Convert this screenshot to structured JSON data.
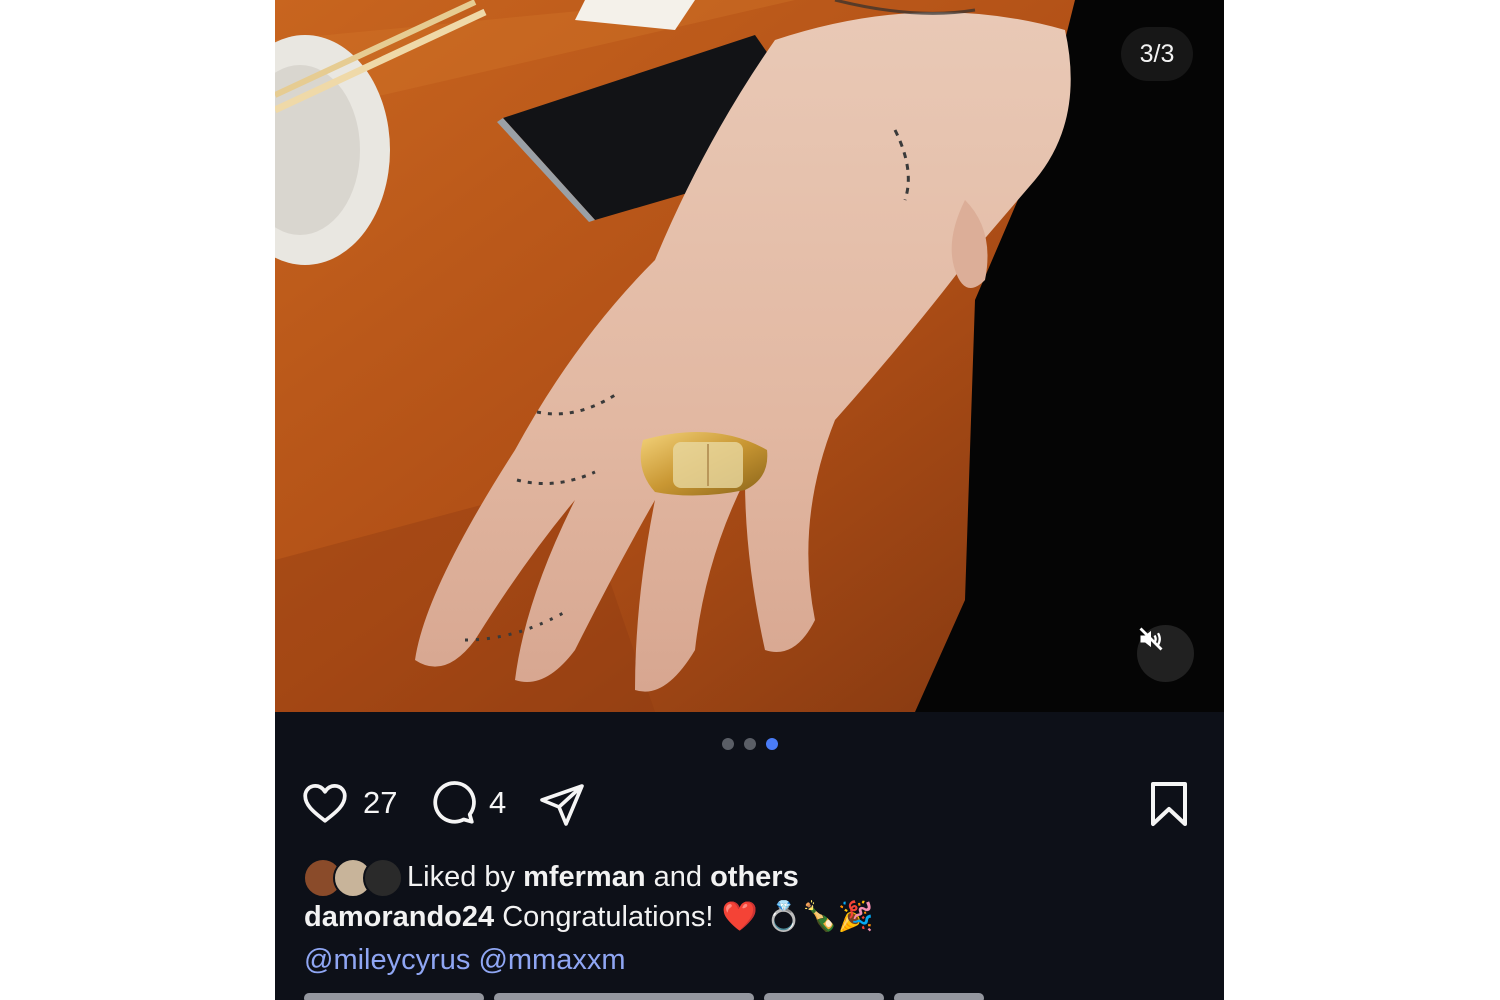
{
  "carousel": {
    "counter": "3/3",
    "total": 3,
    "active_index": 3
  },
  "icons": {
    "mute": "speaker-muted-icon",
    "like": "heart-icon",
    "comment": "speech-bubble-icon",
    "share": "paper-plane-icon",
    "save": "bookmark-icon"
  },
  "actions": {
    "likes_count": "27",
    "comments_count": "4"
  },
  "liked_by": {
    "prefix": "Liked by",
    "user": "mferman",
    "joiner": "and",
    "others": "others"
  },
  "caption": {
    "username": "damorando24",
    "text": "Congratulations! ❤️ 💍🍾🎉",
    "mentions": "@mileycyrus @mmaxxm"
  },
  "colors": {
    "background": "#0d1018",
    "text": "#f2f2f2",
    "mention": "#8fa6f3",
    "active_dot": "#4a7cf6"
  }
}
